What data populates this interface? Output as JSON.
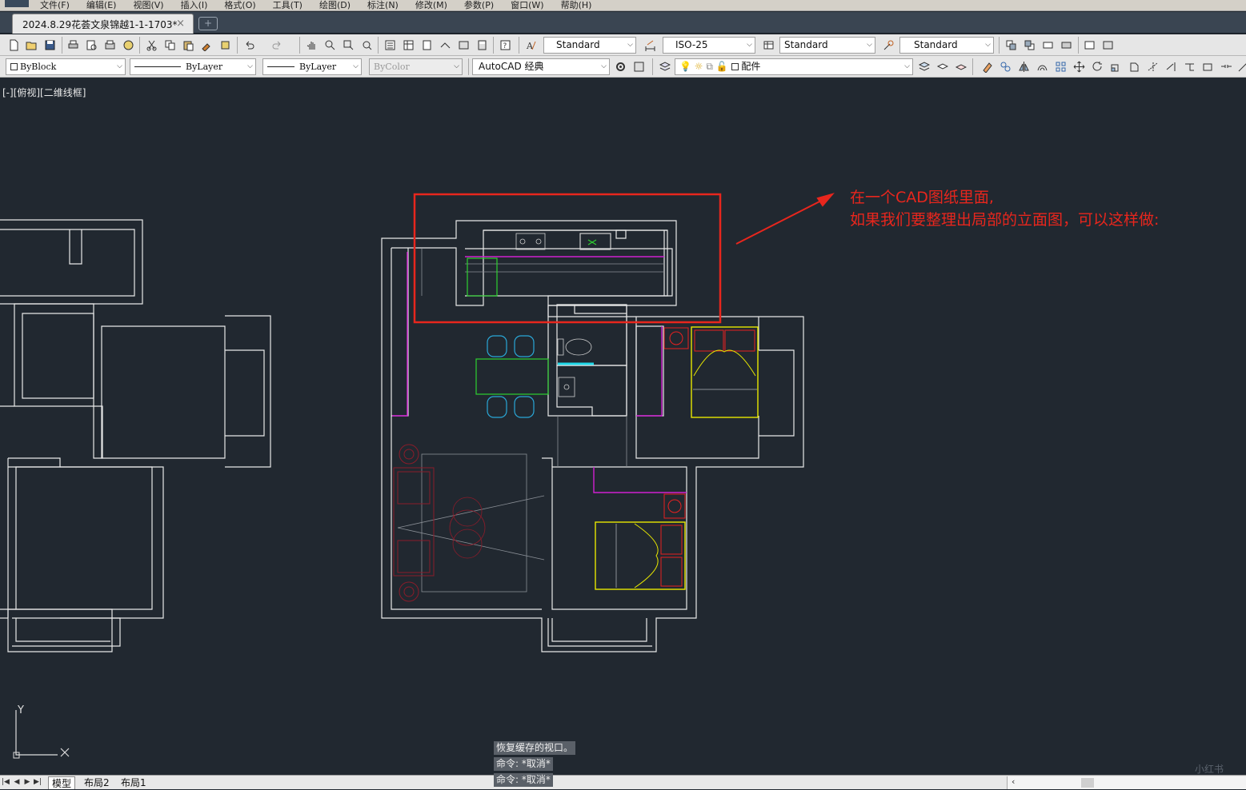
{
  "menu": [
    "文件(F)",
    "编辑(E)",
    "视图(V)",
    "插入(I)",
    "格式(O)",
    "工具(T)",
    "绘图(D)",
    "标注(N)",
    "修改(M)",
    "参数(P)",
    "窗口(W)",
    "帮助(H)"
  ],
  "document_tab": {
    "title": "2024.8.29花荟文泉锦越1-1-1703*",
    "close": "×",
    "new_tab": "+"
  },
  "toolbar1": {
    "text_style": "Standard",
    "dim_style": "ISO-25",
    "table_style": "Standard",
    "multileader_style": "Standard"
  },
  "toolbar2": {
    "color": "ByBlock",
    "linetype": "ByLayer",
    "lineweight": "ByLayer",
    "plotstyle": "ByColor",
    "workspace": "AutoCAD 经典",
    "layer": "配件"
  },
  "viewport": {
    "label": "[-][俯视][二维线框]"
  },
  "annotation": {
    "line1": "在一个CAD图纸里面,",
    "line2": "如果我们要整理出局部的立面图，可以这样做:",
    "color": "#e8261d"
  },
  "ucs": {
    "y_label": "Y"
  },
  "command_history": [
    "恢复缓存的视口。",
    "命令: *取消*",
    "命令: *取消*"
  ],
  "layout_tabs": [
    "模型",
    "布局2",
    "布局1"
  ],
  "active_layout": "模型",
  "watermark": "小红书"
}
